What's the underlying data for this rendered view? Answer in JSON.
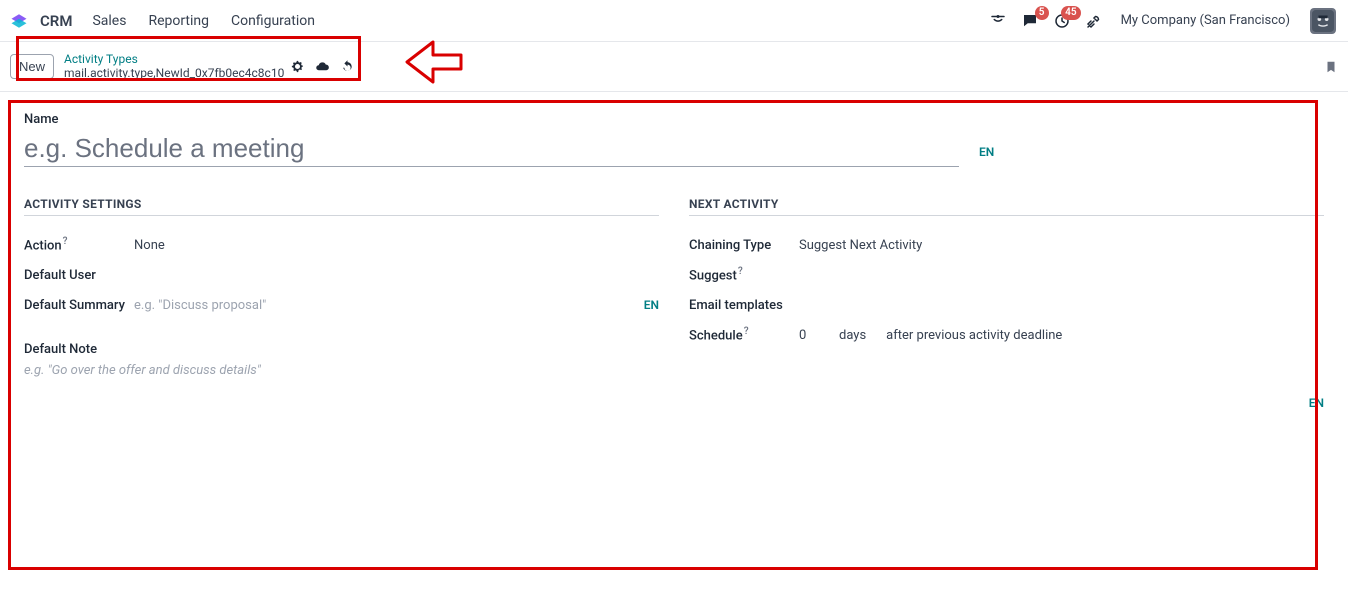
{
  "nav": {
    "app": "CRM",
    "menu": [
      "Sales",
      "Reporting",
      "Configuration"
    ],
    "chat_badge": "5",
    "clock_badge": "45",
    "company": "My Company (San Francisco)"
  },
  "breadcrumb": {
    "new_label": "New",
    "title": "Activity Types",
    "record_tech": "mail.activity.type,NewId_0x7fb0ec4c8c10"
  },
  "form": {
    "name_label": "Name",
    "name_placeholder": "e.g. Schedule a meeting",
    "lang_tag": "EN",
    "left_section": "ACTIVITY SETTINGS",
    "right_section": "NEXT ACTIVITY",
    "action_label": "Action",
    "action_value": "None",
    "default_user_label": "Default User",
    "default_summary_label": "Default Summary",
    "default_summary_placeholder": "e.g. \"Discuss proposal\"",
    "chaining_label": "Chaining Type",
    "chaining_value": "Suggest Next Activity",
    "suggest_label": "Suggest",
    "email_templates_label": "Email templates",
    "schedule_label": "Schedule",
    "schedule_num": "0",
    "schedule_unit": "days",
    "schedule_after": "after previous activity deadline",
    "default_note_label": "Default Note",
    "default_note_placeholder": "e.g. \"Go over the offer and discuss details\""
  }
}
